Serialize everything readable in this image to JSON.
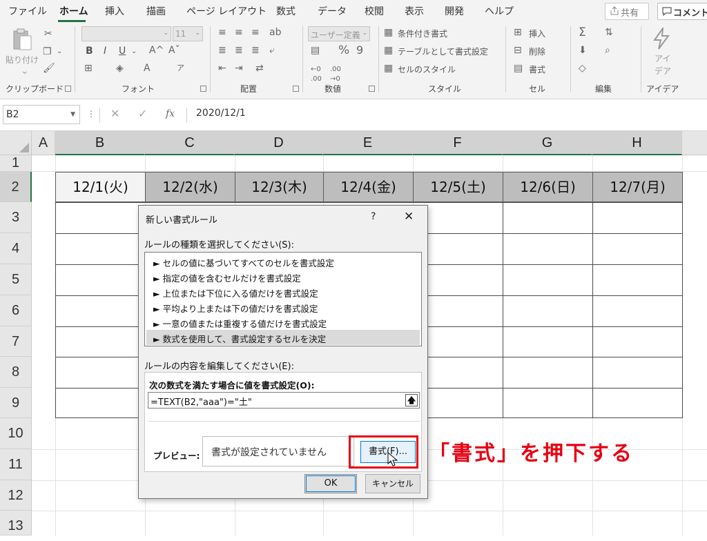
{
  "tabs": [
    "ファイル",
    "ホーム",
    "挿入",
    "描画",
    "ページ レイアウト",
    "数式",
    "データ",
    "校閲",
    "表示",
    "開発",
    "ヘルプ"
  ],
  "share_label": "共有",
  "comment_label": "コメント",
  "ribbon": {
    "clipboard": {
      "paste_label": "貼り付け",
      "group": "クリップボード"
    },
    "font": {
      "size": "11",
      "group": "フォント",
      "bold": "B",
      "italic": "I",
      "underline": "U"
    },
    "alignment": {
      "group": "配置"
    },
    "number": {
      "format": "ユーザー定義",
      "group": "数値"
    },
    "styles": {
      "cond_format": "条件付き書式",
      "table_format": "テーブルとして書式設定",
      "cell_styles": "セルのスタイル",
      "group": "スタイル"
    },
    "cells": {
      "insert": "挿入",
      "delete": "削除",
      "format": "書式",
      "group": "セル"
    },
    "editing": {
      "group": "編集"
    },
    "ideas": {
      "label1": "アイ",
      "label2": "デア",
      "group": "アイデア"
    }
  },
  "formula_bar": {
    "name_box": "B2",
    "formula": "2020/12/1",
    "fx": "fx"
  },
  "columns": [
    "A",
    "B",
    "C",
    "D",
    "E",
    "F",
    "G",
    "H"
  ],
  "rows": [
    "1",
    "2",
    "3",
    "4",
    "5",
    "6",
    "7",
    "8",
    "9",
    "10",
    "11",
    "12",
    "13"
  ],
  "row2_values": [
    "12/1(火)",
    "12/2(水)",
    "12/3(木)",
    "12/4(金)",
    "12/5(土)",
    "12/6(日)",
    "12/7(月)"
  ],
  "dialog": {
    "title": "新しい書式ルール",
    "help": "?",
    "close": "✕",
    "select_label": "ルールの種類を選択してください(S):",
    "rules": [
      "► セルの値に基づいてすべてのセルを書式設定",
      "► 指定の値を含むセルだけを書式設定",
      "► 上位または下位に入る値だけを書式設定",
      "► 平均より上または下の値だけを書式設定",
      "► 一意の値または重複する値だけを書式設定",
      "► 数式を使用して、書式設定するセルを決定"
    ],
    "edit_label": "ルールの内容を編集してください(E):",
    "formula_label": "次の数式を満たす場合に値を書式設定(O):",
    "formula_value": "=TEXT(B2,\"aaa\")=\"土\"",
    "preview_label": "プレビュー:",
    "preview_text": "書式が設定されていません",
    "format_button": "書式(F)...",
    "ok": "OK",
    "cancel": "キャンセル"
  },
  "annotation": "「書式」を押下する",
  "colors": {
    "accent": "#217346",
    "highlight": "#e60012",
    "selected_row_fill": "#bdbdbd"
  }
}
